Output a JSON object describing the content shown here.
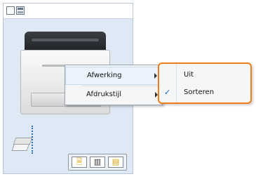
{
  "toolbar": {
    "buttons": [
      "window-icon",
      "layout-icon"
    ]
  },
  "mini_toolbar": {
    "buttons": [
      {
        "icon": "page-icon",
        "glyph": "🗎"
      },
      {
        "icon": "columns-icon",
        "glyph": "▥"
      },
      {
        "icon": "book-icon",
        "glyph": "▤"
      }
    ]
  },
  "context_menu": {
    "items": [
      {
        "label": "Afwerking",
        "has_submenu": true
      },
      {
        "label": "Afdrukstijl",
        "has_submenu": true
      }
    ]
  },
  "submenu": {
    "items": [
      {
        "label": "Uit",
        "checked": false
      },
      {
        "label": "Sorteren",
        "checked": true
      }
    ],
    "check_glyph": "✓",
    "highlight_color": "#ef7d1a"
  },
  "colors": {
    "preview_bg": "#dfe9f5",
    "accent": "#2f6fc8"
  }
}
